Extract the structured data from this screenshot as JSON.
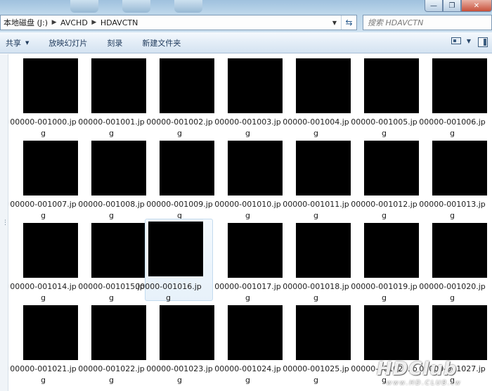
{
  "window": {
    "minimize_glyph": "—",
    "maximize_glyph": "❐",
    "close_glyph": "✕"
  },
  "address": {
    "crumbs": [
      "本地磁盘 (J:)",
      "AVCHD",
      "HDAVCTN"
    ],
    "refresh_glyph": "⇆"
  },
  "search": {
    "placeholder": "搜索 HDAVCTN"
  },
  "toolbar": {
    "share_label": "共享",
    "slideshow_label": "放映幻灯片",
    "burn_label": "刻录",
    "new_folder_label": "新建文件夹"
  },
  "files": [
    "00000-001000.jpg",
    "00000-001001.jpg",
    "00000-001002.jpg",
    "00000-001003.jpg",
    "00000-001004.jpg",
    "00000-001005.jpg",
    "00000-001006.jpg",
    "00000-001007.jpg",
    "00000-001008.jpg",
    "00000-001009.jpg",
    "00000-001010.jpg",
    "00000-001011.jpg",
    "00000-001012.jpg",
    "00000-001013.jpg",
    "00000-001014.jpg",
    "00000-001015.jpg",
    "00000-001016.jpg",
    "00000-001017.jpg",
    "00000-001018.jpg",
    "00000-001019.jpg",
    "00000-001020.jpg",
    "00000-001021.jpg",
    "00000-001022.jpg",
    "00000-001023.jpg",
    "00000-001024.jpg",
    "00000-001025.jpg",
    "00000-001026.jpg",
    "00000-001027.jpg"
  ],
  "selected_file": "00000-001016.jpg",
  "watermark": {
    "main": "HDClub",
    "sub": "www.HD.CLUB.tw"
  },
  "colors": {
    "thumbnail": "#000000",
    "selection_border": "#c3dbef"
  }
}
